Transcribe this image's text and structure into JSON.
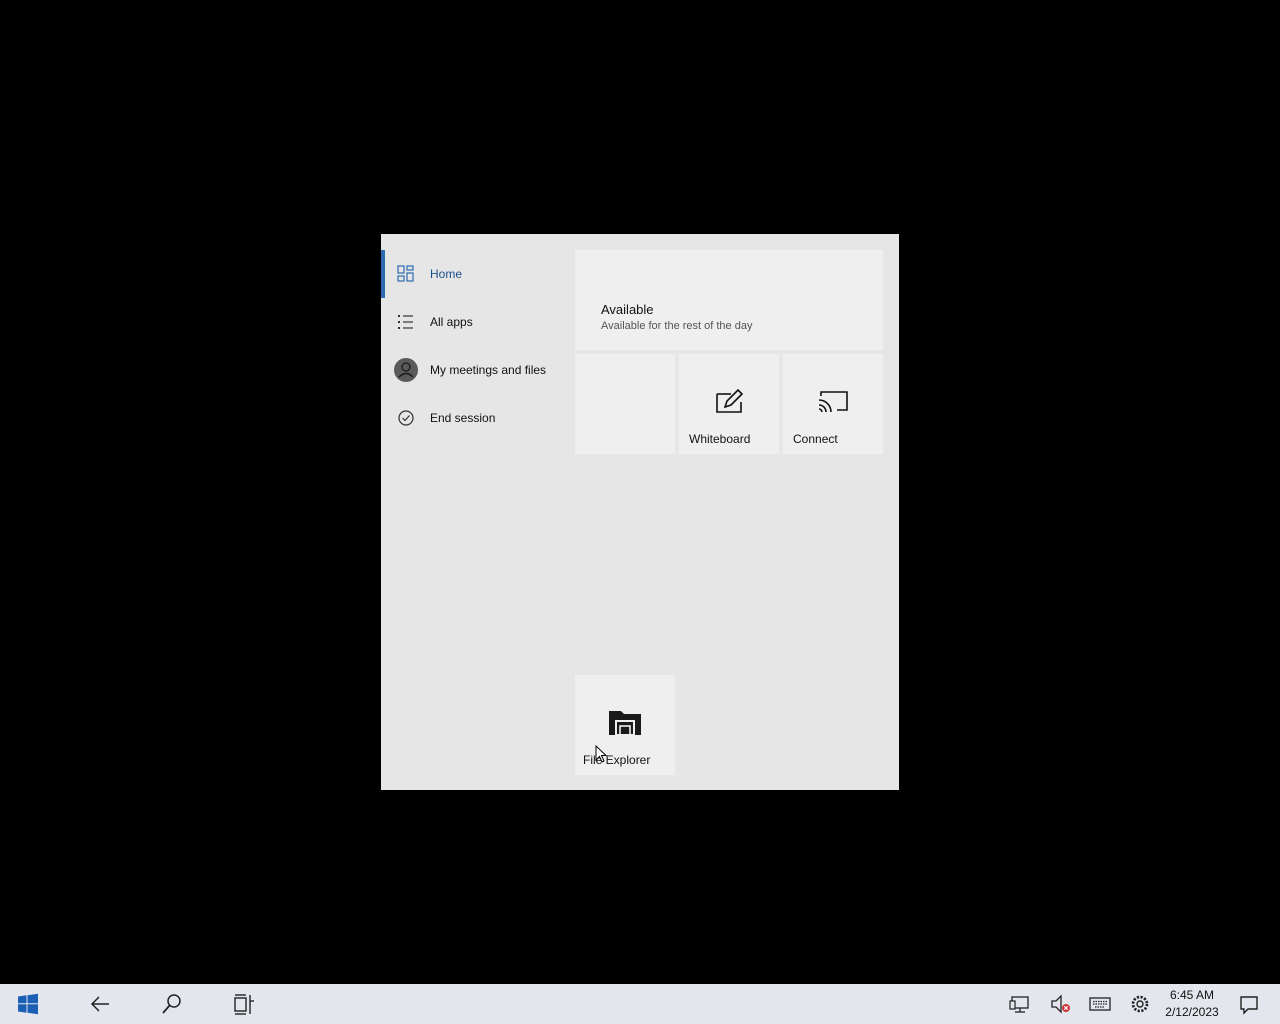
{
  "start_menu": {
    "nav": [
      {
        "label": "Home",
        "icon": "home-grid-icon",
        "active": true
      },
      {
        "label": "All apps",
        "icon": "list-icon",
        "active": false
      },
      {
        "label": "My meetings and files",
        "icon": "avatar-icon",
        "active": false
      },
      {
        "label": "End session",
        "icon": "check-circle-icon",
        "active": false
      }
    ],
    "status": {
      "title": "Available",
      "subtitle": "Available for the rest of the day"
    },
    "tiles": [
      {
        "label": "",
        "icon": ""
      },
      {
        "label": "Whiteboard",
        "icon": "whiteboard-pen-icon"
      },
      {
        "label": "Connect",
        "icon": "cast-screen-icon"
      },
      {
        "label": "File Explorer",
        "icon": "folder-icon"
      }
    ]
  },
  "taskbar": {
    "clock": {
      "time": "6:45 AM",
      "date": "2/12/2023"
    },
    "icons": [
      "windows-start-icon",
      "back-arrow-icon",
      "search-icon",
      "task-view-icon",
      "network-icon",
      "volume-muted-icon",
      "keyboard-icon",
      "settings-icon",
      "notifications-icon"
    ]
  },
  "colors": {
    "accent": "#2b6cb0",
    "menu_bg": "#e6e6e6",
    "tile_bg": "#efefef",
    "taskbar_bg": "#e3e6ec"
  }
}
